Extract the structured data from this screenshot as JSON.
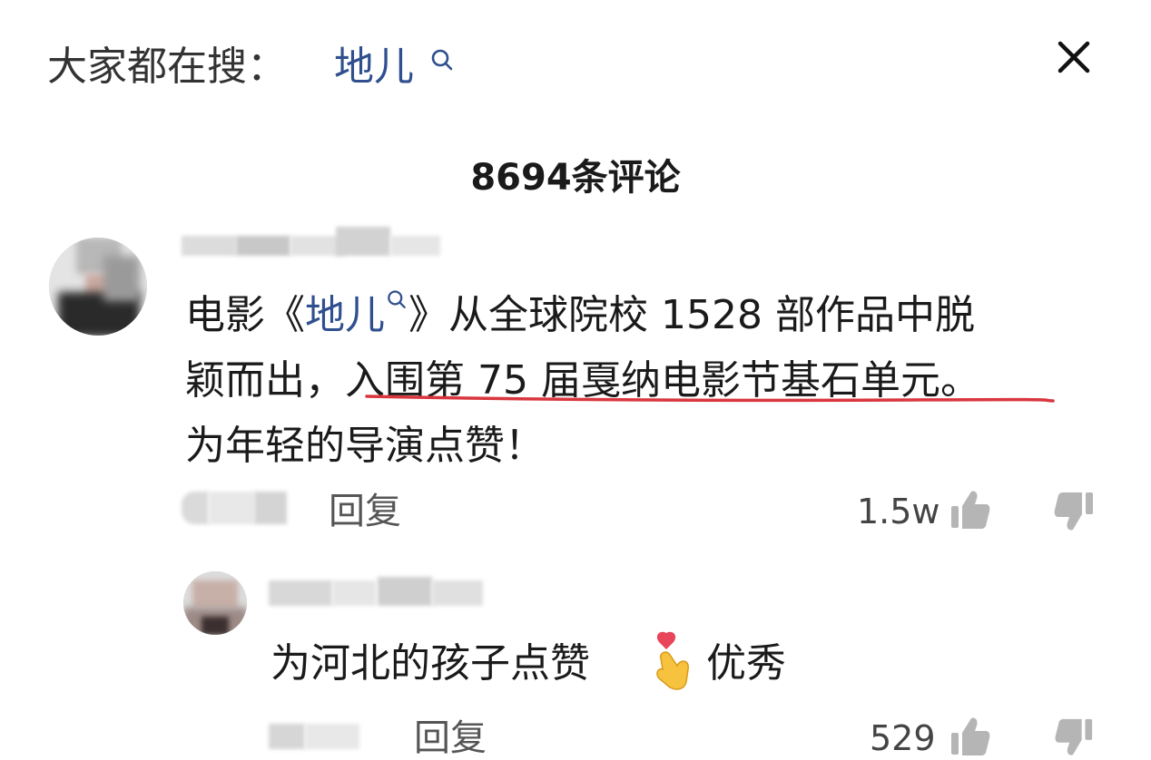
{
  "search": {
    "prefix": "大家都在搜：",
    "keyword": "地儿",
    "keyword_icon": "search-icon",
    "close_icon": "close-icon"
  },
  "comments_header": {
    "count_label": "8694条评论"
  },
  "main_comment": {
    "line1_a": "电影《",
    "line1_link": "地儿",
    "line1_b": "》从全球院校 1528 部作品中脱",
    "line2_a": "颖而出，",
    "line2_highlight": "入围第 75 届戛纳电影节基石单元。",
    "line3": "为年轻的导演点赞！",
    "reply_label": "回复",
    "like_count": "1.5w",
    "like_icon": "thumbs-up-icon",
    "dislike_icon": "thumbs-down-icon",
    "highlight_color": "#d9363e",
    "link_color": "#2f4f8e"
  },
  "reply_comment": {
    "text_a": "为河北的孩子点赞",
    "emoji": "finger-heart-emoji",
    "text_b": "优秀",
    "reply_label": "回复",
    "like_count": "529",
    "like_icon": "thumbs-up-icon",
    "dislike_icon": "thumbs-down-icon"
  }
}
